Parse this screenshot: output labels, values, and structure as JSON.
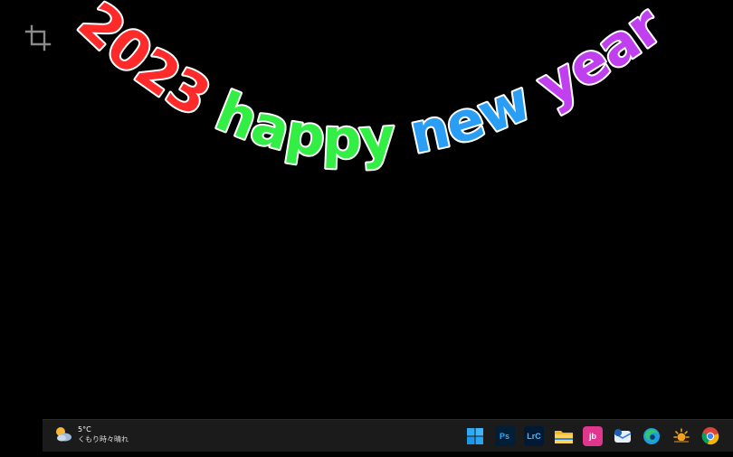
{
  "arc_text": {
    "words": [
      {
        "text": "2023",
        "color": "#ff2a2a"
      },
      {
        "text": "happy",
        "color": "#33ee44"
      },
      {
        "text": "new",
        "color": "#2a9df4"
      },
      {
        "text": "year",
        "color": "#c040f0"
      }
    ]
  },
  "toolbar": {
    "crop_icon": "crop-icon"
  },
  "taskbar": {
    "weather": {
      "temperature": "5°C",
      "condition": "くもり時々晴れ",
      "icon": "partly-cloudy-icon"
    },
    "apps": [
      {
        "name": "start",
        "label": "",
        "icon": "windows-start-icon"
      },
      {
        "name": "photoshop",
        "label": "Ps",
        "icon": "photoshop-icon"
      },
      {
        "name": "lightroom-classic",
        "label": "LrC",
        "icon": "lightroom-classic-icon"
      },
      {
        "name": "file-explorer",
        "label": "",
        "icon": "folder-icon"
      },
      {
        "name": "app-jb",
        "label": "jb",
        "icon": "jb-app-icon"
      },
      {
        "name": "mail",
        "label": "",
        "icon": "mail-icon"
      },
      {
        "name": "edge",
        "label": "",
        "icon": "edge-icon"
      },
      {
        "name": "sun-app",
        "label": "",
        "icon": "sun-icon"
      },
      {
        "name": "chrome",
        "label": "",
        "icon": "chrome-icon"
      }
    ]
  }
}
